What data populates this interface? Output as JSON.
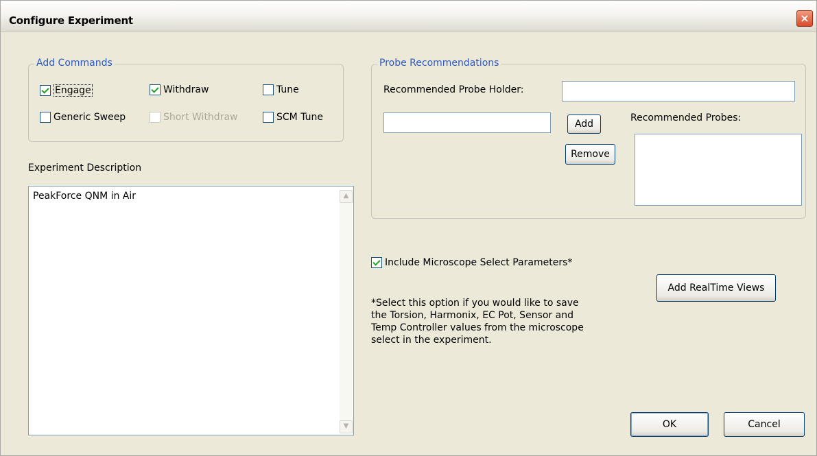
{
  "window": {
    "title": "Configure Experiment",
    "close_glyph": "×"
  },
  "add_commands": {
    "legend": "Add Commands",
    "engage": "Engage",
    "withdraw": "Withdraw",
    "tune": "Tune",
    "generic_sweep": "Generic Sweep",
    "short_withdraw": "Short Withdraw",
    "scm_tune": "SCM Tune"
  },
  "description": {
    "label": "Experiment Description",
    "value": "PeakForce QNM in Air"
  },
  "probe": {
    "legend": "Probe Recommendations",
    "holder_label": "Recommended Probe Holder:",
    "holder_value": "",
    "probe_input_value": "",
    "add_label": "Add",
    "remove_label": "Remove",
    "probes_label": "Recommended Probes:"
  },
  "options": {
    "include_label": "Include Microscope Select Parameters*",
    "note": "*Select this option if you would like to save the Torsion, Harmonix, EC Pot, Sensor and Temp Controller values from the microscope select in the experiment.",
    "realtime_label": "Add RealTime Views"
  },
  "footer": {
    "ok_label": "OK",
    "cancel_label": "Cancel"
  },
  "icons": {
    "scroll_up": "▲",
    "scroll_down": "▼"
  },
  "colors": {
    "accent_legend": "#2c59c6",
    "close_button": "#d94a2a",
    "check": "#21a121"
  }
}
